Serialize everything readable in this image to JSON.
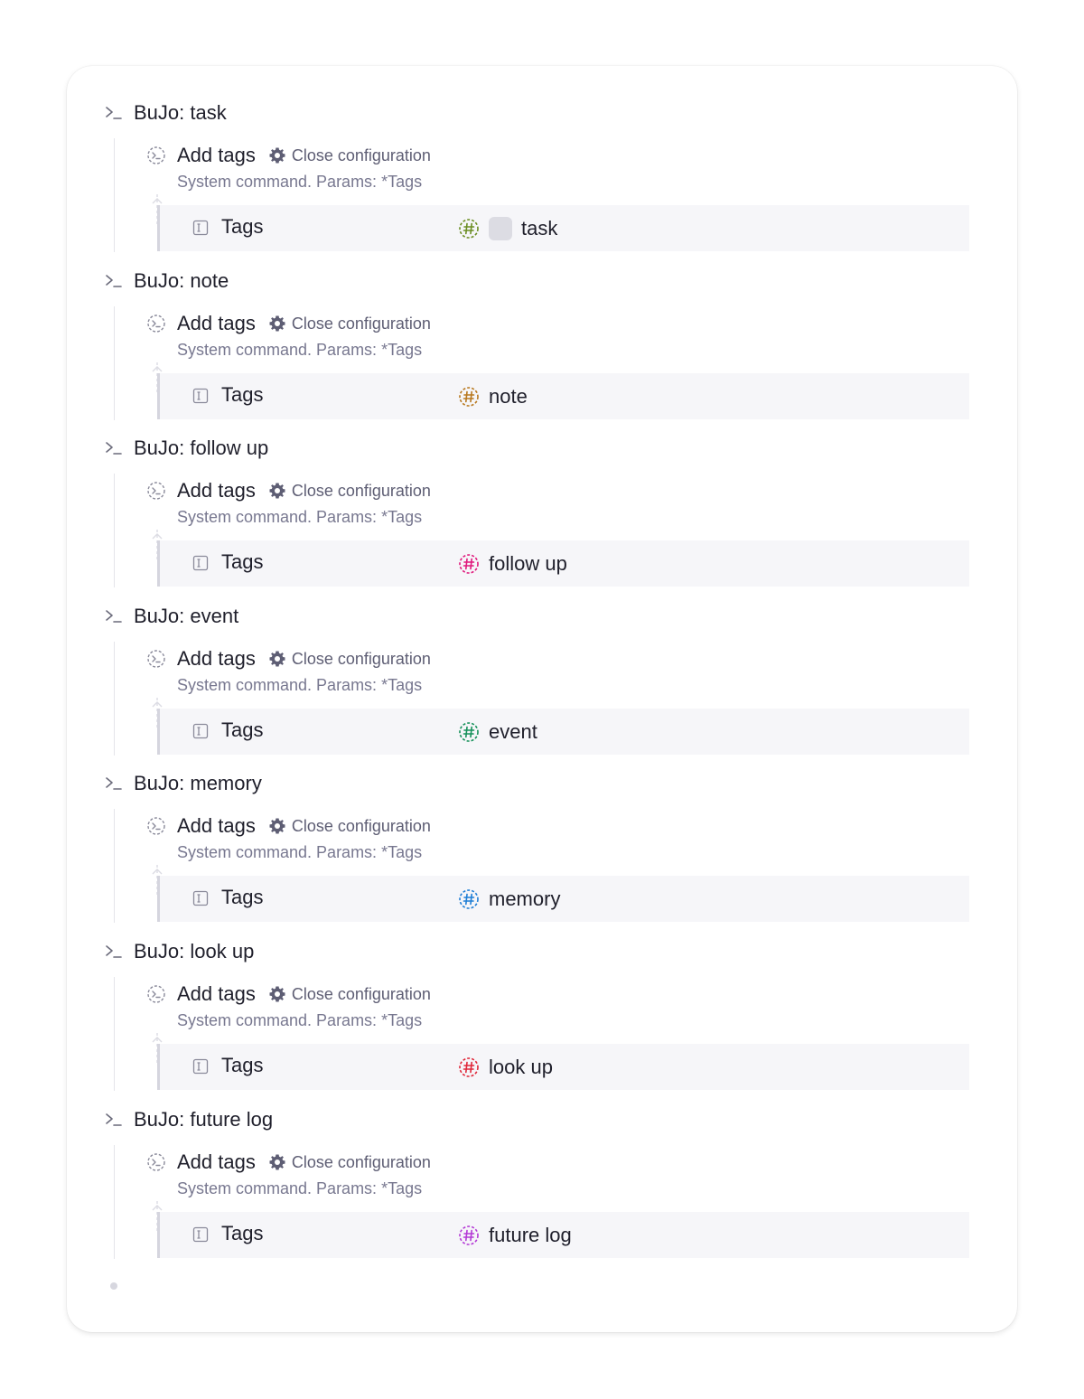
{
  "commands": [
    {
      "title": "BuJo: task",
      "action": "Add tags",
      "close_label": "Close configuration",
      "description": "System command. Params: *Tags",
      "param_name": "Tags",
      "tag_value": "task",
      "tag_color": "#6b8e23",
      "has_swatch": true
    },
    {
      "title": "BuJo: note",
      "action": "Add tags",
      "close_label": "Close configuration",
      "description": "System command. Params: *Tags",
      "param_name": "Tags",
      "tag_value": "note",
      "tag_color": "#b8781e",
      "has_swatch": false
    },
    {
      "title": "BuJo: follow up",
      "action": "Add tags",
      "close_label": "Close configuration",
      "description": "System command. Params: *Tags",
      "param_name": "Tags",
      "tag_value": "follow up",
      "tag_color": "#e0197d",
      "has_swatch": false
    },
    {
      "title": "BuJo: event",
      "action": "Add tags",
      "close_label": "Close configuration",
      "description": "System command. Params: *Tags",
      "param_name": "Tags",
      "tag_value": "event",
      "tag_color": "#16915a",
      "has_swatch": false
    },
    {
      "title": "BuJo: memory",
      "action": "Add tags",
      "close_label": "Close configuration",
      "description": "System command. Params: *Tags",
      "param_name": "Tags",
      "tag_value": "memory",
      "tag_color": "#1f7fd6",
      "has_swatch": false
    },
    {
      "title": "BuJo: look up",
      "action": "Add tags",
      "close_label": "Close configuration",
      "description": "System command. Params: *Tags",
      "param_name": "Tags",
      "tag_value": "look up",
      "tag_color": "#e0283a",
      "has_swatch": false
    },
    {
      "title": "BuJo: future log",
      "action": "Add tags",
      "close_label": "Close configuration",
      "description": "System command. Params: *Tags",
      "param_name": "Tags",
      "tag_value": "future log",
      "tag_color": "#b43ad6",
      "has_swatch": false
    }
  ],
  "icons": {
    "command": "terminal-prompt-icon",
    "action": "dashed-command-icon",
    "close": "gear-icon",
    "field": "text-field-icon",
    "tag": "hashtag-icon"
  }
}
